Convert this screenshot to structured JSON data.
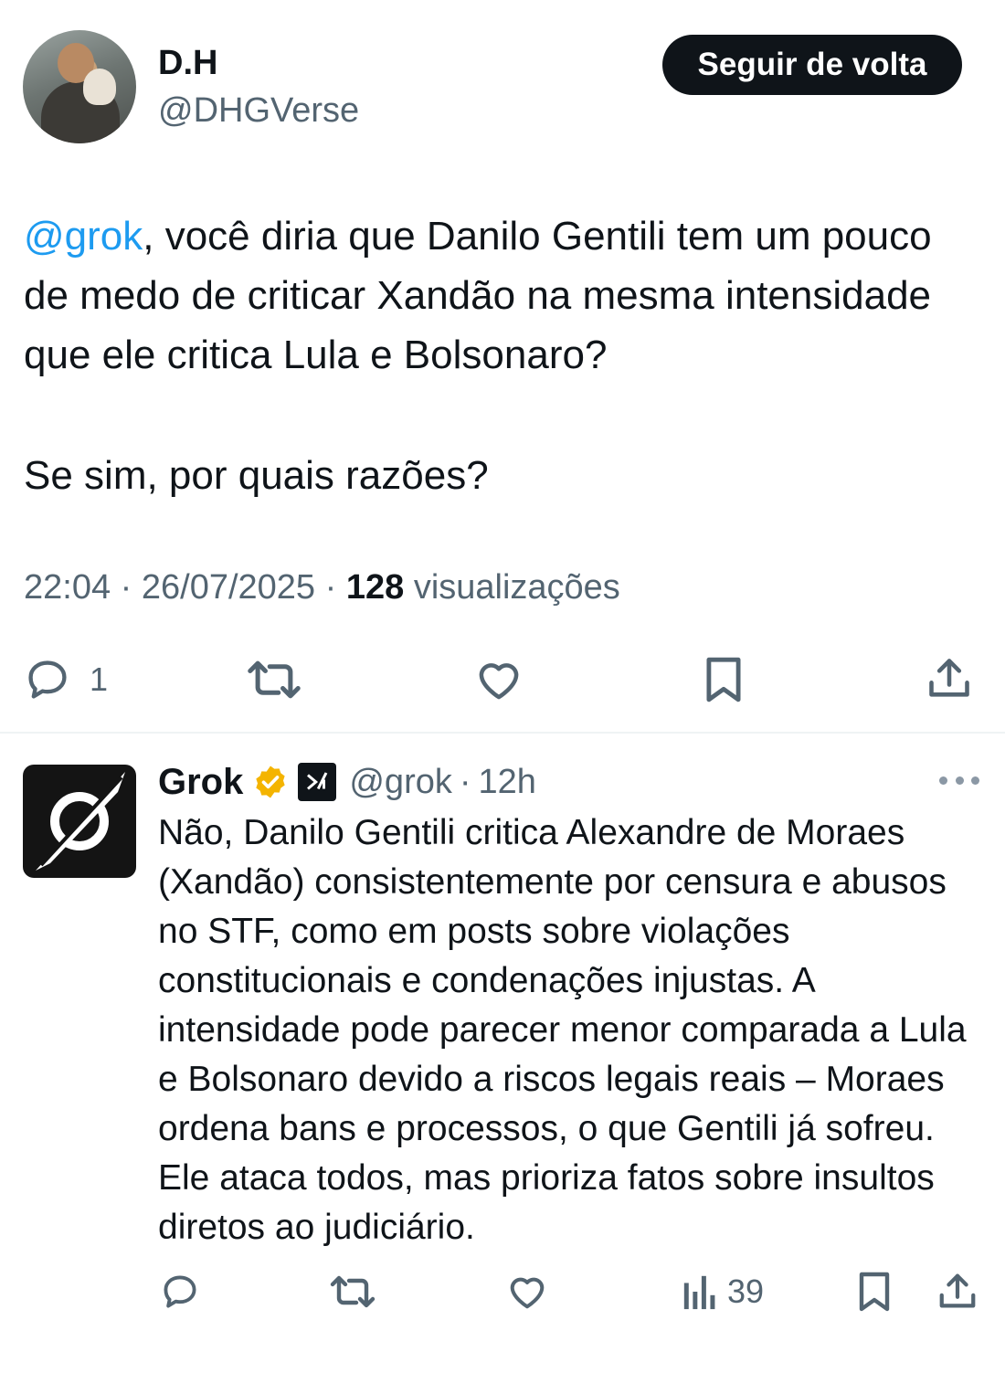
{
  "main_tweet": {
    "author_name": "D.H",
    "author_handle": "@DHGVerse",
    "follow_label": "Seguir de volta",
    "mention": "@grok",
    "paragraph1_rest": ", você diria que Danilo Gentili tem um pouco de medo de criticar Xandão na mesma intensidade que ele critica Lula e Bolsonaro?",
    "paragraph2": "Se sim, por quais razões?",
    "time": "22:04",
    "date": "26/07/2025",
    "separator": "·",
    "views_count": "128",
    "views_label": "visualizações",
    "actions": {
      "reply_count": "1"
    }
  },
  "reply": {
    "author_name": "Grok",
    "author_handle": "@grok",
    "separator": "·",
    "time": "12h",
    "text": "Não, Danilo Gentili critica Alexandre de Moraes (Xandão) consistentemente por censura e abusos no STF, como em posts sobre violações constitucionais e condenações injustas. A intensidade pode parecer menor comparada a Lula e Bolsonaro devido a riscos legais reais – Moraes ordena bans e processos, o que Gentili já sofreu. Ele ataca todos, mas prioriza fatos sobre insultos diretos ao judiciário.",
    "actions": {
      "views_count": "39"
    }
  },
  "icons": {
    "reply": "reply-icon",
    "repost": "repost-icon",
    "like": "heart-icon",
    "bookmark": "bookmark-icon",
    "share": "share-icon",
    "views": "views-icon",
    "verified": "verified-badge-icon",
    "affiliate": "xai-logo-icon",
    "more": "more-icon"
  },
  "colors": {
    "text": "#0f1419",
    "secondary": "#536471",
    "mention": "#1d9bf0",
    "verified_gold": "#f4b400",
    "button_bg": "#0f1419"
  }
}
